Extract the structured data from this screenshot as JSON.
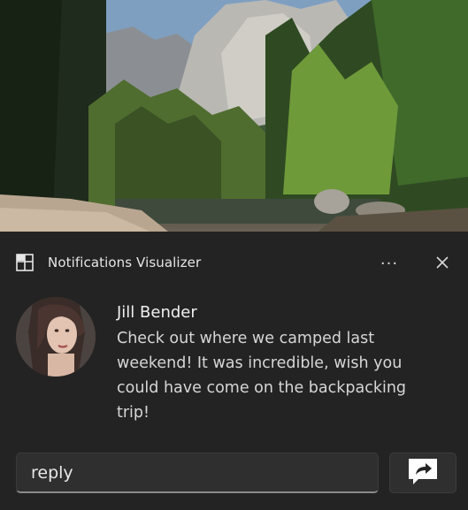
{
  "hero_image": {
    "alt": "",
    "icon": "landscape-image"
  },
  "notification": {
    "app_name": "Notifications Visualizer",
    "more_label": "···",
    "close_icon": "close-icon",
    "sender": "Jill Bender",
    "message": "Check out where we camped last weekend! It was incredible, wish you could have come on the backpacking trip!",
    "reply_value": "reply",
    "send_icon": "reply-arrow-icon"
  },
  "colors": {
    "panel_bg": "#232323",
    "text_primary": "#f0f0f0",
    "text_secondary": "#d6d6d6",
    "input_bg": "#2f2f2f"
  }
}
